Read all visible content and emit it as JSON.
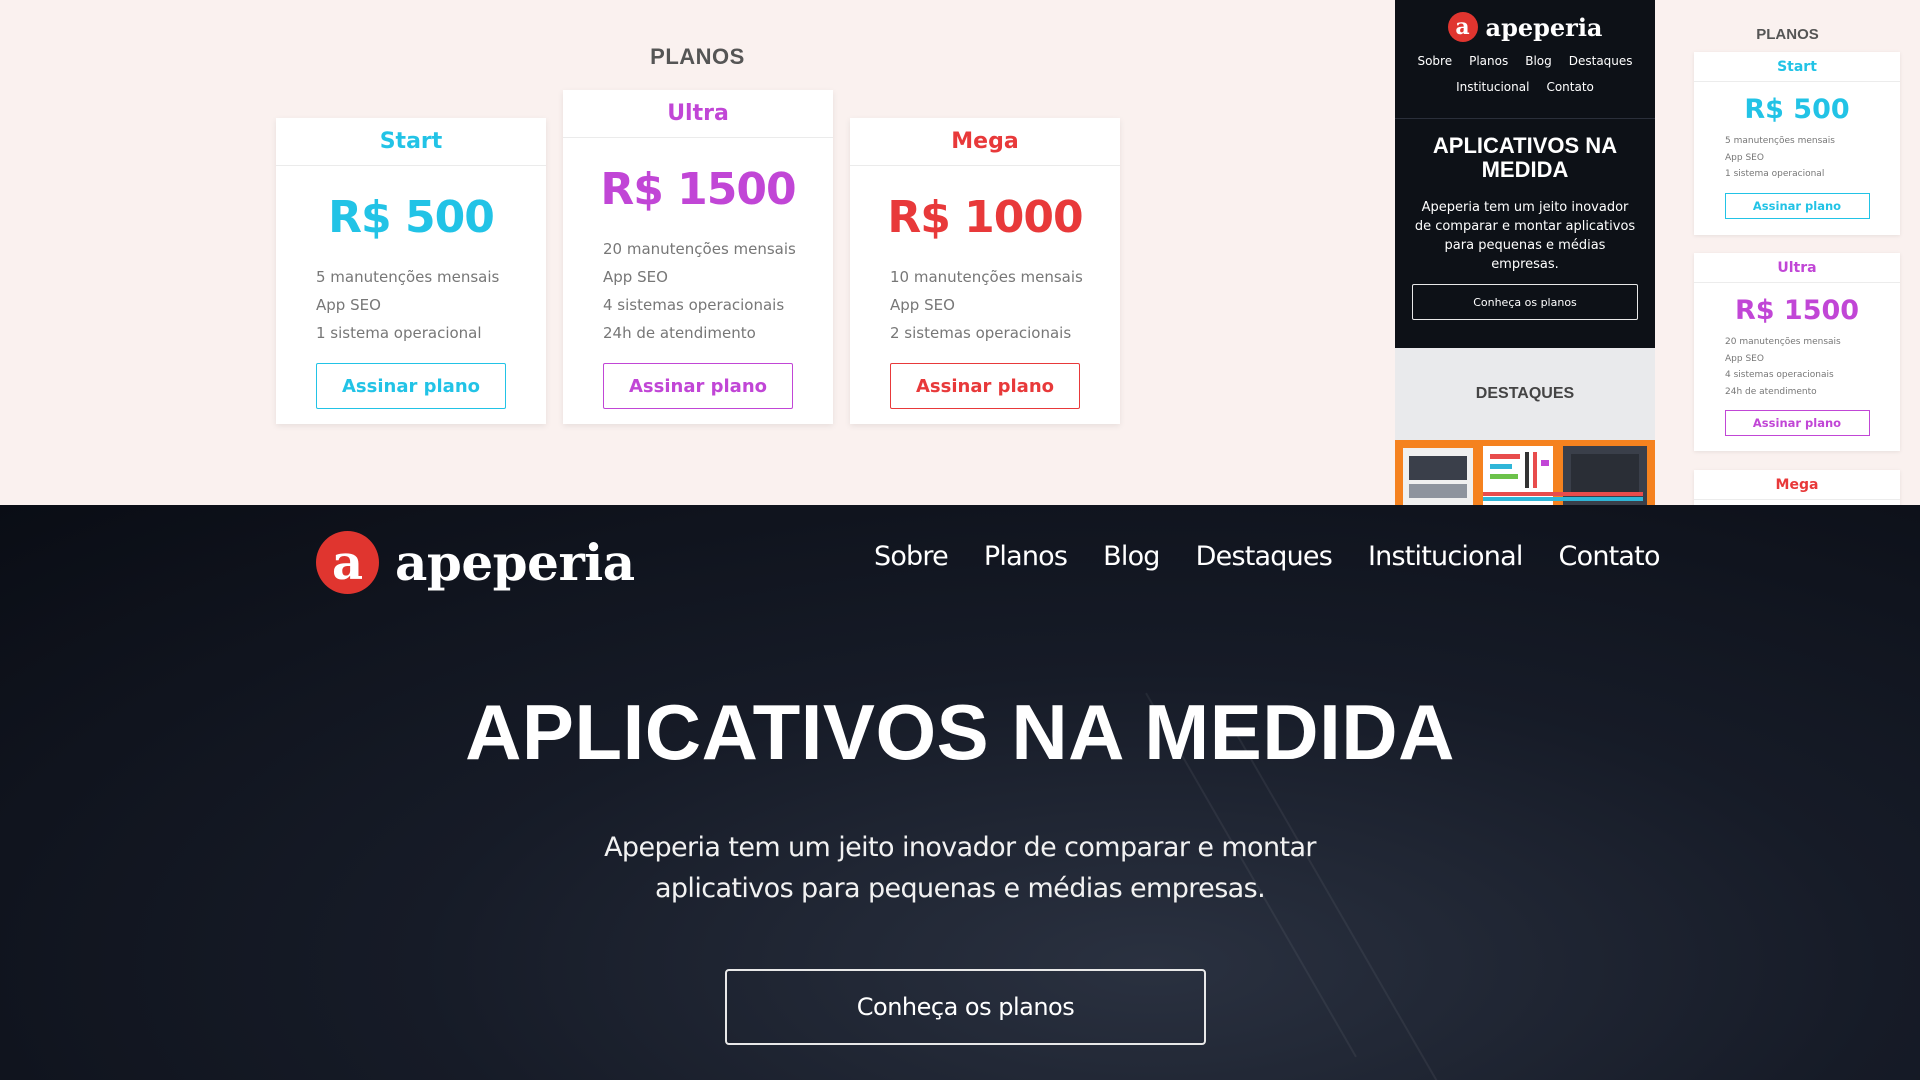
{
  "colors": {
    "start": "#22c3e6",
    "ultra": "#c146d6",
    "mega": "#e8393a",
    "logo_red": "#e0352f"
  },
  "pricing": {
    "title": "PLANOS",
    "plans": [
      {
        "name": "Start",
        "price": "R$ 500",
        "features": [
          "5 manutenções mensais",
          "App SEO",
          "1 sistema operacional"
        ],
        "button": "Assinar plano"
      },
      {
        "name": "Ultra",
        "price": "R$ 1500",
        "features": [
          "20 manutenções mensais",
          "App SEO",
          "4 sistemas operacionais",
          "24h de atendimento"
        ],
        "button": "Assinar plano"
      },
      {
        "name": "Mega",
        "price": "R$ 1000",
        "features": [
          "10 manutenções mensais",
          "App SEO",
          "2 sistemas operacionais"
        ],
        "button": "Assinar plano"
      }
    ]
  },
  "mobile": {
    "logo_letter": "a",
    "brand": "apeperia",
    "nav": [
      "Sobre",
      "Planos",
      "Blog",
      "Destaques",
      "Institucional",
      "Contato"
    ],
    "headline": "APLICATIVOS NA MEDIDA",
    "subtitle": "Apeperia tem um jeito inovador de comparar e montar aplicativos para pequenas e médias empresas.",
    "cta": "Conheça os planos",
    "section": "DESTAQUES"
  },
  "mini": {
    "title": "PLANOS",
    "plans": [
      {
        "name": "Start",
        "price": "R$ 500",
        "features": [
          "5 manutenções mensais",
          "App SEO",
          "1 sistema operacional"
        ],
        "button": "Assinar plano"
      },
      {
        "name": "Ultra",
        "price": "R$ 1500",
        "features": [
          "20 manutenções mensais",
          "App SEO",
          "4 sistemas operacionais",
          "24h de atendimento"
        ],
        "button": "Assinar plano"
      },
      {
        "name": "Mega"
      }
    ]
  },
  "hero": {
    "logo_letter": "a",
    "brand": "apeperia",
    "nav": [
      "Sobre",
      "Planos",
      "Blog",
      "Destaques",
      "Institucional",
      "Contato"
    ],
    "headline": "APLICATIVOS NA MEDIDA",
    "subtitle_line1": "Apeperia tem um jeito inovador de comparar e montar",
    "subtitle_line2": "aplicativos para pequenas e médias empresas.",
    "cta": "Conheça os planos"
  }
}
